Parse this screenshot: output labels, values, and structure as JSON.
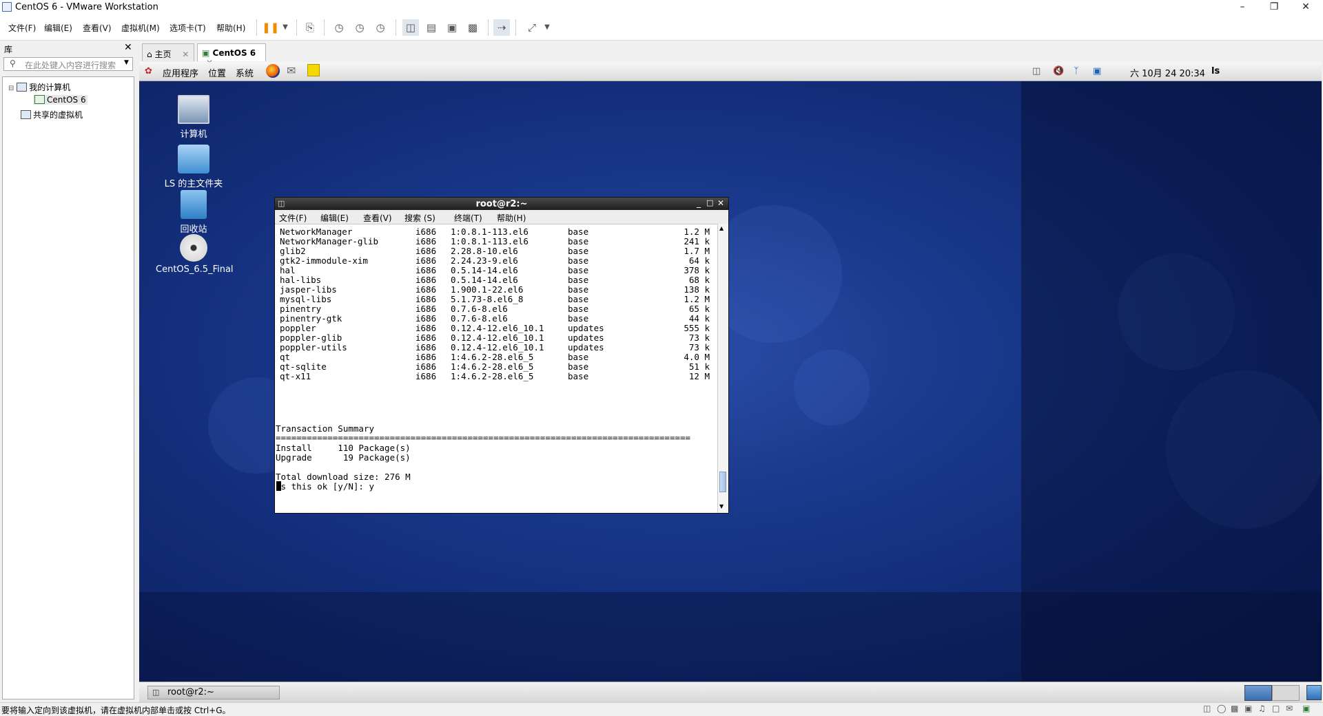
{
  "window": {
    "title": "CentOS 6 - VMware Workstation"
  },
  "menubar": {
    "items": [
      "文件(F)",
      "编辑(E)",
      "查看(V)",
      "虚拟机(M)",
      "选项卡(T)",
      "帮助(H)"
    ]
  },
  "library": {
    "title": "库",
    "search_placeholder": "在此处键入内容进行搜索",
    "tree": {
      "my_computer": "我的计算机",
      "vm": "CentOS 6",
      "shared": "共享的虚拟机"
    }
  },
  "tabs": [
    {
      "label": "主页"
    },
    {
      "label": "CentOS 6"
    }
  ],
  "guest": {
    "panel": {
      "apps": "应用程序",
      "places": "位置",
      "system": "系统",
      "datetime": "六 10月 24 20:34",
      "user": "ls"
    },
    "desktop_icons": [
      {
        "label": "计算机",
        "icon": "computer-icon"
      },
      {
        "label": "LS 的主文件夹",
        "icon": "home-folder-icon"
      },
      {
        "label": "回收站",
        "icon": "trash-icon"
      },
      {
        "label": "CentOS_6.5_Final",
        "icon": "dvd-icon"
      }
    ],
    "terminal": {
      "title": "root@r2:~",
      "menu": [
        "文件(F)",
        "编辑(E)",
        "查看(V)",
        "搜索 (S)",
        "终端(T)",
        "帮助(H)"
      ],
      "packages": [
        {
          "name": "NetworkManager",
          "arch": "i686",
          "version": "1:0.8.1-113.el6",
          "repo": "base",
          "size": "1.2 M"
        },
        {
          "name": "NetworkManager-glib",
          "arch": "i686",
          "version": "1:0.8.1-113.el6",
          "repo": "base",
          "size": "241 k"
        },
        {
          "name": "glib2",
          "arch": "i686",
          "version": "2.28.8-10.el6",
          "repo": "base",
          "size": "1.7 M"
        },
        {
          "name": "gtk2-immodule-xim",
          "arch": "i686",
          "version": "2.24.23-9.el6",
          "repo": "base",
          "size": "64 k"
        },
        {
          "name": "hal",
          "arch": "i686",
          "version": "0.5.14-14.el6",
          "repo": "base",
          "size": "378 k"
        },
        {
          "name": "hal-libs",
          "arch": "i686",
          "version": "0.5.14-14.el6",
          "repo": "base",
          "size": "68 k"
        },
        {
          "name": "jasper-libs",
          "arch": "i686",
          "version": "1.900.1-22.el6",
          "repo": "base",
          "size": "138 k"
        },
        {
          "name": "mysql-libs",
          "arch": "i686",
          "version": "5.1.73-8.el6_8",
          "repo": "base",
          "size": "1.2 M"
        },
        {
          "name": "pinentry",
          "arch": "i686",
          "version": "0.7.6-8.el6",
          "repo": "base",
          "size": "65 k"
        },
        {
          "name": "pinentry-gtk",
          "arch": "i686",
          "version": "0.7.6-8.el6",
          "repo": "base",
          "size": "44 k"
        },
        {
          "name": "poppler",
          "arch": "i686",
          "version": "0.12.4-12.el6_10.1",
          "repo": "updates",
          "size": "555 k"
        },
        {
          "name": "poppler-glib",
          "arch": "i686",
          "version": "0.12.4-12.el6_10.1",
          "repo": "updates",
          "size": "73 k"
        },
        {
          "name": "poppler-utils",
          "arch": "i686",
          "version": "0.12.4-12.el6_10.1",
          "repo": "updates",
          "size": "73 k"
        },
        {
          "name": "qt",
          "arch": "i686",
          "version": "1:4.6.2-28.el6_5",
          "repo": "base",
          "size": "4.0 M"
        },
        {
          "name": "qt-sqlite",
          "arch": "i686",
          "version": "1:4.6.2-28.el6_5",
          "repo": "base",
          "size": "51 k"
        },
        {
          "name": "qt-x11",
          "arch": "i686",
          "version": "1:4.6.2-28.el6_5",
          "repo": "base",
          "size": "12 M"
        }
      ],
      "summary_title": "Transaction Summary",
      "separator": "================================================================================",
      "install_line": "Install     110 Package(s)",
      "upgrade_line": "Upgrade      19 Package(s)",
      "download_line": "Total download size: 276 M",
      "prompt": "Is this ok [y/N]: y"
    },
    "taskbar": {
      "window_button": "root@r2:~"
    }
  },
  "statusbar": {
    "message": "要将输入定向到该虚拟机，请在虚拟机内部单击或按 Ctrl+G。"
  },
  "colors": {
    "desktop": "#1b3a8e",
    "term_title": "#2a2a2a",
    "accent_orange": "#f08c00"
  }
}
